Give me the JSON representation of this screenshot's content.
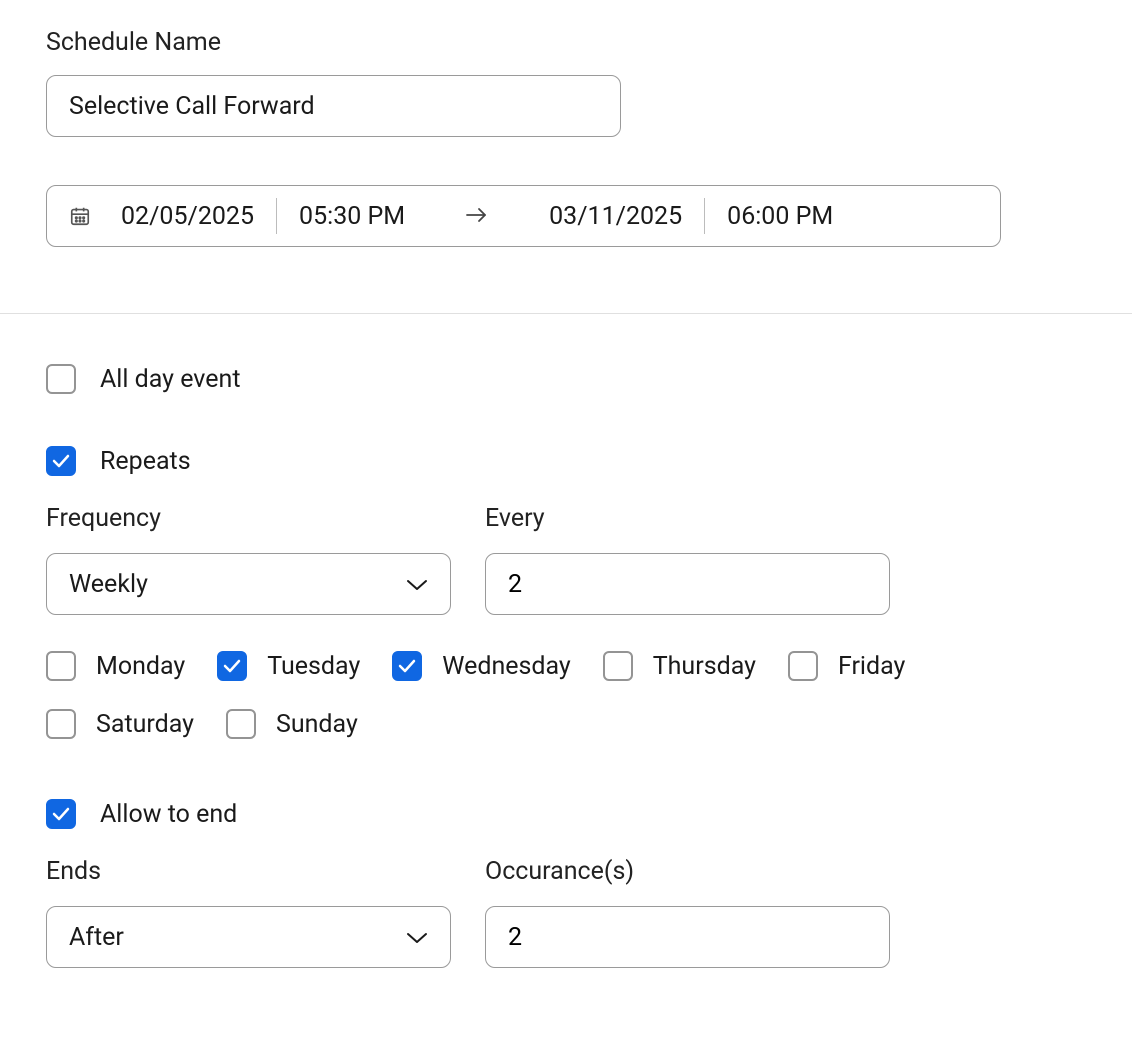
{
  "schedule_name_label": "Schedule Name",
  "schedule_name_value": "Selective Call Forward",
  "date_range": {
    "start_date": "02/05/2025",
    "start_time": "05:30 PM",
    "end_date": "03/11/2025",
    "end_time": "06:00 PM"
  },
  "all_day_label": "All day event",
  "all_day_checked": false,
  "repeats_label": "Repeats",
  "repeats_checked": true,
  "frequency_label": "Frequency",
  "frequency_value": "Weekly",
  "every_label": "Every",
  "every_value": "2",
  "days": [
    {
      "label": "Monday",
      "checked": false
    },
    {
      "label": "Tuesday",
      "checked": true
    },
    {
      "label": "Wednesday",
      "checked": true
    },
    {
      "label": "Thursday",
      "checked": false
    },
    {
      "label": "Friday",
      "checked": false
    },
    {
      "label": "Saturday",
      "checked": false
    },
    {
      "label": "Sunday",
      "checked": false
    }
  ],
  "allow_end_label": "Allow to end",
  "allow_end_checked": true,
  "ends_label": "Ends",
  "ends_value": "After",
  "occurrences_label": "Occurance(s)",
  "occurrences_value": "2"
}
